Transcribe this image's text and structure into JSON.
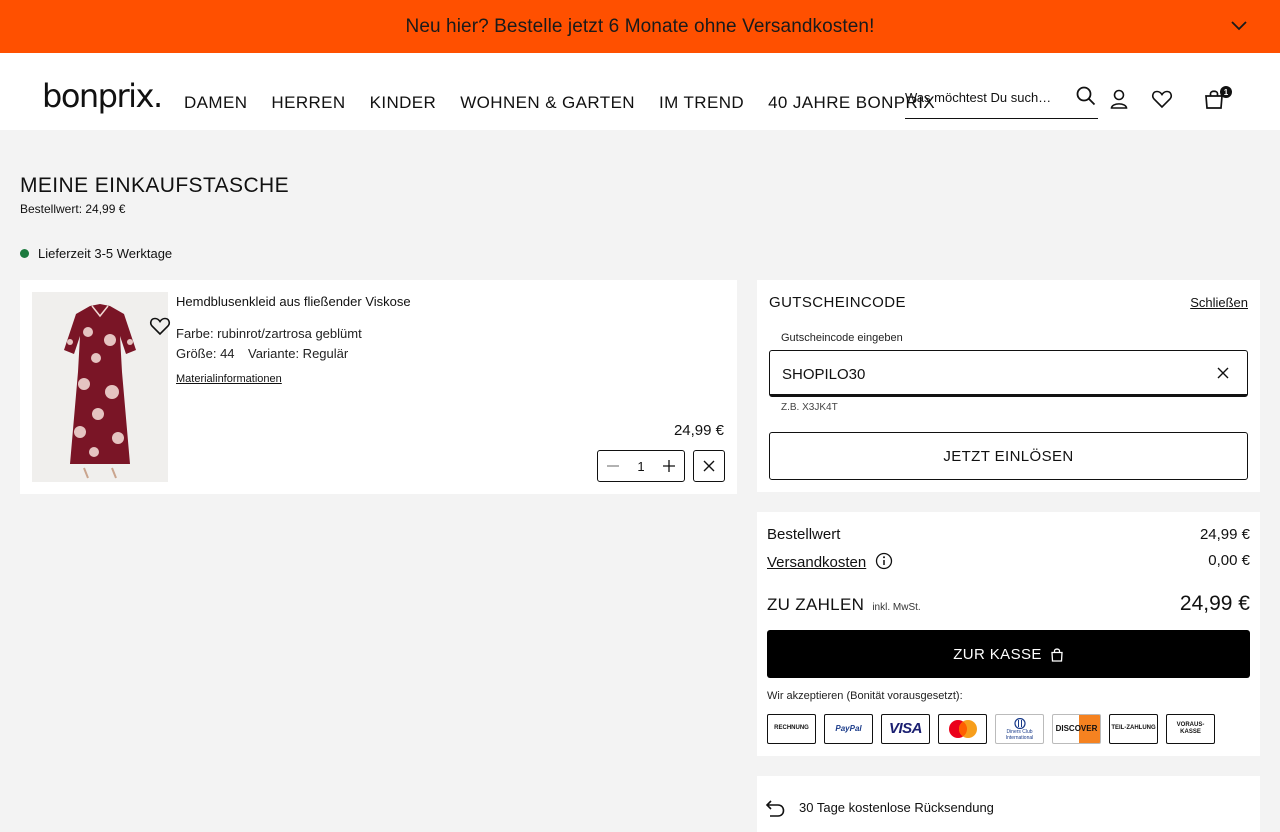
{
  "promo": {
    "text": "Neu hier? Bestelle jetzt 6 Monate ohne Versandkosten!"
  },
  "header": {
    "logo": "bonprix.",
    "nav": [
      "DAMEN",
      "HERREN",
      "KINDER",
      "WOHNEN & GARTEN",
      "IM TREND",
      "40 JAHRE BONPRIX"
    ],
    "search_placeholder": "Was möchtest Du such…",
    "cart_count": "1"
  },
  "cart": {
    "title": "MEINE EINKAUFSTASCHE",
    "order_value": "Bestellwert: 24,99 €",
    "delivery": "Lieferzeit 3-5 Werktage",
    "item": {
      "name": "Hemdblusenkleid aus fließender Viskose",
      "color": "Farbe: rubinrot/zartrosa geblümt",
      "size": "Größe: 44",
      "variant": "Variante: Regulär",
      "material_link": "Materialinformationen",
      "price": "24,99 €",
      "quantity": "1"
    }
  },
  "voucher": {
    "title": "GUTSCHEINCODE",
    "close": "Schließen",
    "label": "Gutscheincode eingeben",
    "value": "SHOPILO30",
    "hint": "Z.B. X3JK4T",
    "redeem": "JETZT EINLÖSEN"
  },
  "summary": {
    "order_label": "Bestellwert",
    "order_value": "24,99 €",
    "shipping_label": "Versandkosten",
    "shipping_value": "0,00 €",
    "total_label": "ZU ZAHLEN",
    "total_sub": "inkl. MwSt.",
    "total_value": "24,99 €",
    "checkout": "ZUR KASSE",
    "accept": "Wir akzeptieren (Bonität vorausgesetzt):",
    "payments": [
      "RECHNUNG",
      "PayPal",
      "VISA",
      "Mastercard",
      "Diners Club International",
      "DISCOVER",
      "TEIL-ZAHLUNG",
      "VORAUS-KASSE"
    ]
  },
  "returns": {
    "text": "30 Tage kostenlose Rücksendung"
  },
  "colors": {
    "promo_bg": "#ff5000",
    "delivery_dot": "#1c7a3e",
    "checkout_bg": "#000000"
  }
}
